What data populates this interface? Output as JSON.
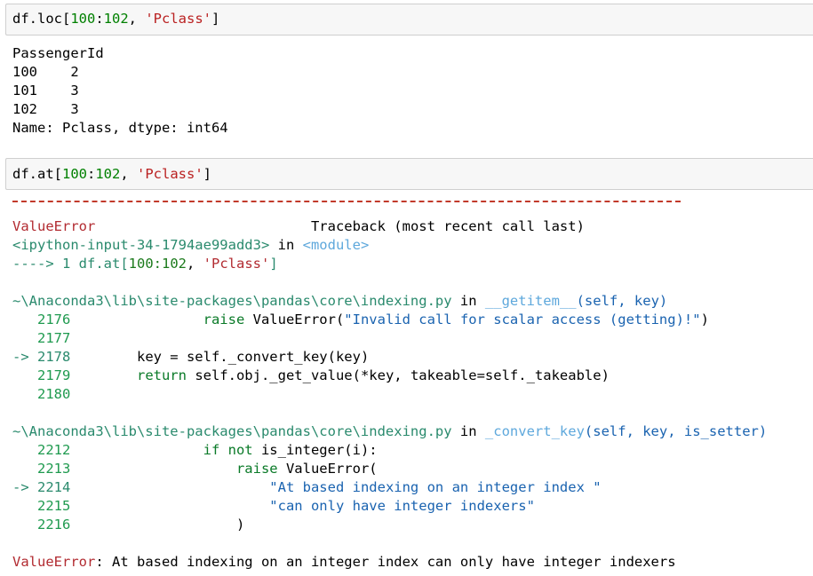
{
  "cell1": {
    "code": {
      "prefix": "df.loc[",
      "start": "100",
      "colon": ":",
      "end": "102",
      "comma": ", ",
      "str": "'Pclass'",
      "suffix": "]"
    }
  },
  "out1": {
    "header": "PassengerId",
    "rows": [
      {
        "idx": "100",
        "val": "2"
      },
      {
        "idx": "101",
        "val": "3"
      },
      {
        "idx": "102",
        "val": "3"
      }
    ],
    "footer": "Name: Pclass, dtype: int64"
  },
  "cell2": {
    "code": {
      "prefix": "df.at[",
      "start": "100",
      "colon": ":",
      "end": "102",
      "comma": ", ",
      "str": "'Pclass'",
      "suffix": "]"
    }
  },
  "tb": {
    "err_name": "ValueError",
    "tb_label": "Traceback (most recent call last)",
    "input_ref": "<ipython-input-34-1794ae99add3>",
    "in_kw": " in ",
    "module": "<module>",
    "arrow1": "----> 1 df.at[",
    "arrow1_nums": "100:102",
    "arrow1_sep": ", ",
    "arrow1_str": "'Pclass'",
    "arrow1_end": "]",
    "file": "~\\Anaconda3\\lib\\site-packages\\pandas\\core\\indexing.py",
    "frame1": {
      "func": "__getitem__",
      "args": "(self, key)",
      "lines": [
        {
          "no": "2176",
          "pre": "                ",
          "kw": "raise",
          "mid": " ValueError(",
          "str": "\"Invalid call for scalar access (getting)!\"",
          "post": ")"
        },
        {
          "no": "2177",
          "pre": "",
          "kw": "",
          "mid": "",
          "str": "",
          "post": ""
        },
        {
          "no": "2178",
          "arrow": "-> ",
          "pre": "        ",
          "kw": "",
          "mid": "key = self._convert_key(key)",
          "str": "",
          "post": ""
        },
        {
          "no": "2179",
          "pre": "        ",
          "kw": "return",
          "mid": " self.obj._get_value(*key, takeable=self._takeable)",
          "str": "",
          "post": ""
        },
        {
          "no": "2180",
          "pre": "",
          "kw": "",
          "mid": "",
          "str": "",
          "post": ""
        }
      ]
    },
    "frame2": {
      "func": "_convert_key",
      "args": "(self, key, is_setter)",
      "lines": [
        {
          "no": "2212",
          "pre": "                ",
          "kw": "if not",
          "mid": " is_integer(i):",
          "str": "",
          "post": ""
        },
        {
          "no": "2213",
          "pre": "                    ",
          "kw": "raise",
          "mid": " ValueError(",
          "str": "",
          "post": ""
        },
        {
          "no": "2214",
          "arrow": "-> ",
          "pre": "                        ",
          "kw": "",
          "mid": "",
          "str": "\"At based indexing on an integer index \"",
          "post": ""
        },
        {
          "no": "2215",
          "pre": "                        ",
          "kw": "",
          "mid": "",
          "str": "\"can only have integer indexers\"",
          "post": ""
        },
        {
          "no": "2216",
          "pre": "                    ",
          "kw": "",
          "mid": ")",
          "str": "",
          "post": ""
        }
      ]
    },
    "final_err": "ValueError",
    "final_msg": ": At based indexing on an integer index can only have integer indexers"
  }
}
